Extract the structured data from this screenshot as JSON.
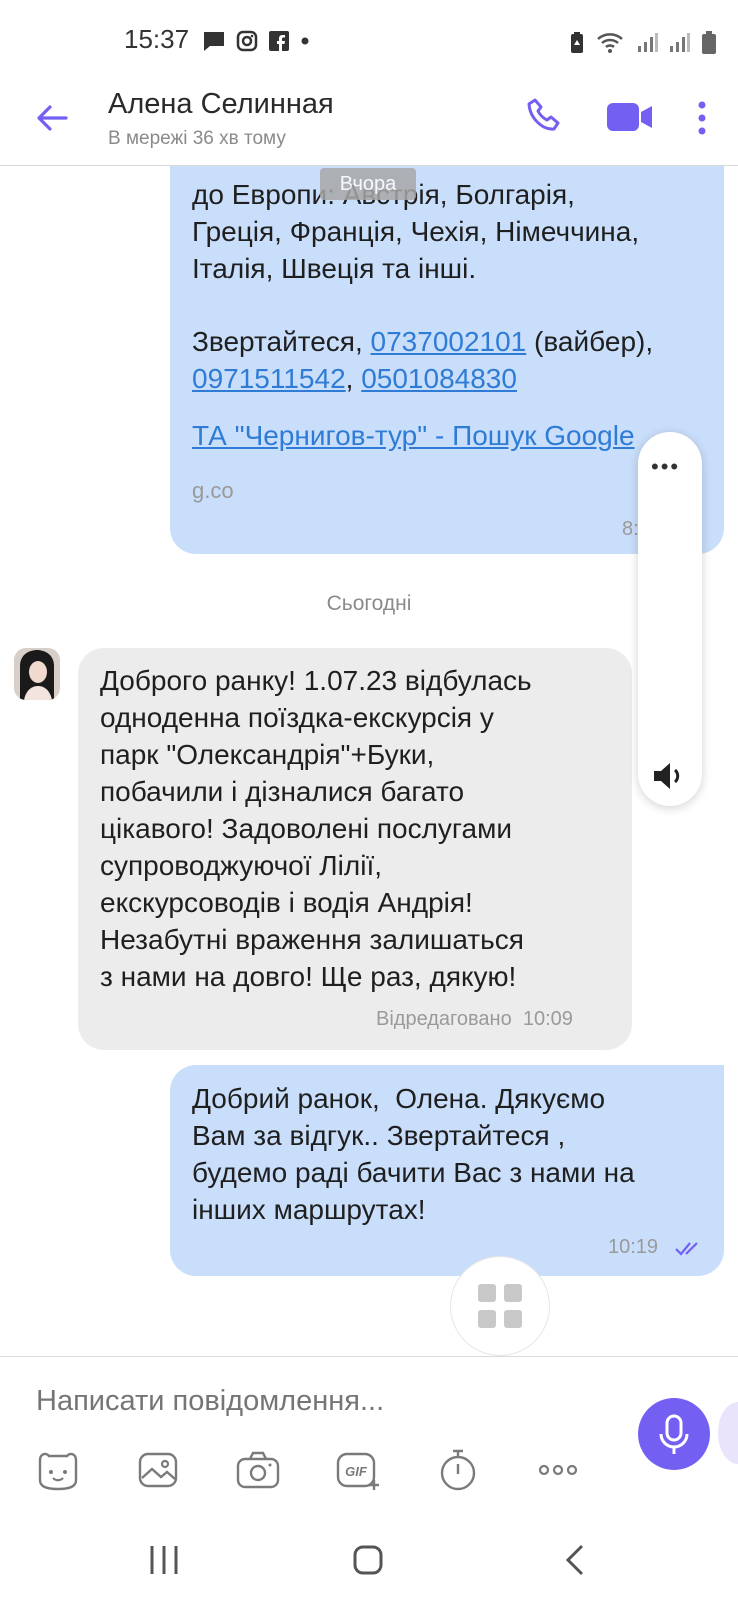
{
  "status_bar": {
    "time": "15:37",
    "left_icons": [
      "message-icon",
      "instagram-icon",
      "facebook-icon",
      "dot-icon"
    ],
    "right_icons": [
      "battery-saver-icon",
      "wifi-icon",
      "signal-icon",
      "signal-icon",
      "battery-icon"
    ]
  },
  "header": {
    "contact_name": "Алена Селинная",
    "status": "В мережі 36 хв тому"
  },
  "date_chip": "Вчора",
  "messages": [
    {
      "direction": "outgoing",
      "text": "до Европи: Австрія, Болгарія,\nГреція, Франція, Чехія, Німеччина,\nІталія, Швеція та інші.",
      "contacts_prefix": "Звертайтеся, ",
      "phone1": "0737002101",
      "phone1_suffix": " (вайбер),",
      "phone2": "0971511542",
      "separator": ", ",
      "phone3": "0501084830",
      "link_title": "ТА \"Чернигов-тур\" - Пошук Google",
      "link_domain": "g.co",
      "time": "8:"
    },
    {
      "direction": "incoming",
      "text": "Доброго ранку! 1.07.23 відбулась\nодноденна поїздка-екскурсія у\nпарк \"Олександрія\"+Буки,\nпобачили і дізналися багато\nцікавого! Задоволені послугами\nсупроводжуючої Лілії,\nекскурсоводів і водія Андрія!\nНезабутні враження залишаться\nз нами на довго! Ще раз, дякую!",
      "edited_label": "Відредаговано",
      "time": "10:09"
    },
    {
      "direction": "outgoing",
      "text": "Добрий ранок,  Олена. Дякуємо\nВам за відгук.. Звертайтеся ,\nбудемо раді бачити Вас з нами на\nінших маршрутах!",
      "time": "10:19",
      "status": "read"
    }
  ],
  "today_label": "Сьогодні",
  "float_panel": {
    "top": "•••"
  },
  "composer": {
    "placeholder": "Написати повідомлення..."
  },
  "toolbar": [
    "sticker-icon",
    "gallery-icon",
    "camera-icon",
    "gif-icon",
    "timer-icon",
    "more-icon"
  ],
  "colors": {
    "accent": "#7360f2",
    "outgoing_bubble": "#c9defa",
    "incoming_bubble": "#ececec",
    "link": "#2f7cd6"
  }
}
